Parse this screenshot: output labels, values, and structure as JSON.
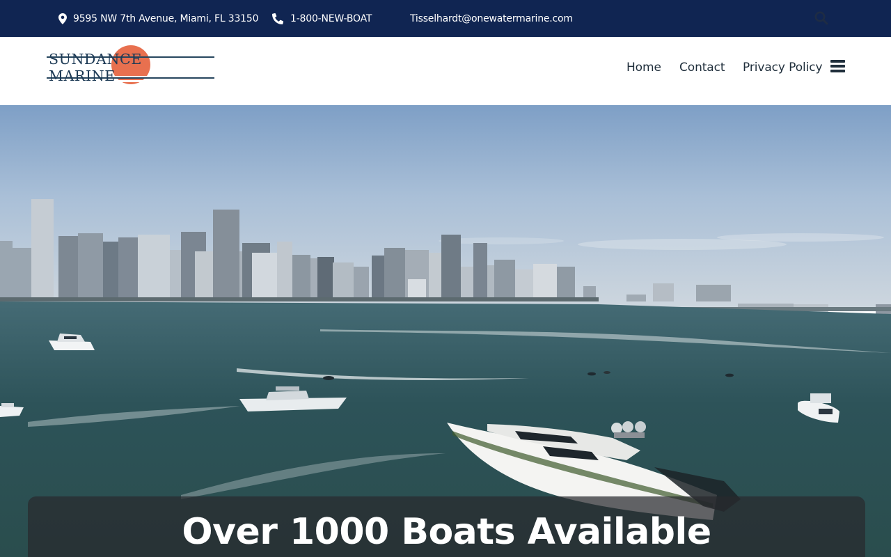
{
  "topbar": {
    "address": "9595 NW 7th Avenue, Miami, FL 33150",
    "phone": "1-800-NEW-BOAT",
    "email": "Tisselhardt@onewatermarine.com"
  },
  "header": {
    "logo_text": "SUNDANCE MARINE",
    "nav": [
      {
        "label": "Home"
      },
      {
        "label": "Contact"
      },
      {
        "label": "Privacy Policy"
      }
    ]
  },
  "hero": {
    "title": "Over 1000 Boats Available"
  },
  "colors": {
    "topbar_bg": "#102552",
    "logo_sun": "#e8704f",
    "logo_navy": "#1d3a55",
    "nav_text": "#1f2e3b"
  },
  "icons": {
    "address": "map-marker-icon",
    "phone": "phone-icon",
    "search": "search-icon",
    "menu": "hamburger-menu-icon"
  }
}
